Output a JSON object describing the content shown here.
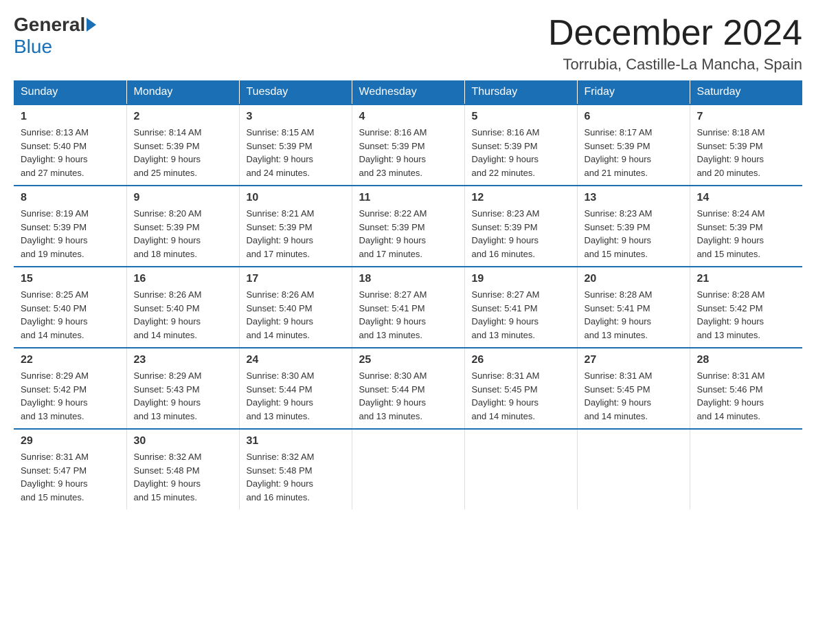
{
  "logo": {
    "general": "General",
    "blue": "Blue"
  },
  "title": "December 2024",
  "subtitle": "Torrubia, Castille-La Mancha, Spain",
  "days_of_week": [
    "Sunday",
    "Monday",
    "Tuesday",
    "Wednesday",
    "Thursday",
    "Friday",
    "Saturday"
  ],
  "weeks": [
    [
      {
        "day": "1",
        "sunrise": "8:13 AM",
        "sunset": "5:40 PM",
        "daylight": "9 hours and 27 minutes."
      },
      {
        "day": "2",
        "sunrise": "8:14 AM",
        "sunset": "5:39 PM",
        "daylight": "9 hours and 25 minutes."
      },
      {
        "day": "3",
        "sunrise": "8:15 AM",
        "sunset": "5:39 PM",
        "daylight": "9 hours and 24 minutes."
      },
      {
        "day": "4",
        "sunrise": "8:16 AM",
        "sunset": "5:39 PM",
        "daylight": "9 hours and 23 minutes."
      },
      {
        "day": "5",
        "sunrise": "8:16 AM",
        "sunset": "5:39 PM",
        "daylight": "9 hours and 22 minutes."
      },
      {
        "day": "6",
        "sunrise": "8:17 AM",
        "sunset": "5:39 PM",
        "daylight": "9 hours and 21 minutes."
      },
      {
        "day": "7",
        "sunrise": "8:18 AM",
        "sunset": "5:39 PM",
        "daylight": "9 hours and 20 minutes."
      }
    ],
    [
      {
        "day": "8",
        "sunrise": "8:19 AM",
        "sunset": "5:39 PM",
        "daylight": "9 hours and 19 minutes."
      },
      {
        "day": "9",
        "sunrise": "8:20 AM",
        "sunset": "5:39 PM",
        "daylight": "9 hours and 18 minutes."
      },
      {
        "day": "10",
        "sunrise": "8:21 AM",
        "sunset": "5:39 PM",
        "daylight": "9 hours and 17 minutes."
      },
      {
        "day": "11",
        "sunrise": "8:22 AM",
        "sunset": "5:39 PM",
        "daylight": "9 hours and 17 minutes."
      },
      {
        "day": "12",
        "sunrise": "8:23 AM",
        "sunset": "5:39 PM",
        "daylight": "9 hours and 16 minutes."
      },
      {
        "day": "13",
        "sunrise": "8:23 AM",
        "sunset": "5:39 PM",
        "daylight": "9 hours and 15 minutes."
      },
      {
        "day": "14",
        "sunrise": "8:24 AM",
        "sunset": "5:39 PM",
        "daylight": "9 hours and 15 minutes."
      }
    ],
    [
      {
        "day": "15",
        "sunrise": "8:25 AM",
        "sunset": "5:40 PM",
        "daylight": "9 hours and 14 minutes."
      },
      {
        "day": "16",
        "sunrise": "8:26 AM",
        "sunset": "5:40 PM",
        "daylight": "9 hours and 14 minutes."
      },
      {
        "day": "17",
        "sunrise": "8:26 AM",
        "sunset": "5:40 PM",
        "daylight": "9 hours and 14 minutes."
      },
      {
        "day": "18",
        "sunrise": "8:27 AM",
        "sunset": "5:41 PM",
        "daylight": "9 hours and 13 minutes."
      },
      {
        "day": "19",
        "sunrise": "8:27 AM",
        "sunset": "5:41 PM",
        "daylight": "9 hours and 13 minutes."
      },
      {
        "day": "20",
        "sunrise": "8:28 AM",
        "sunset": "5:41 PM",
        "daylight": "9 hours and 13 minutes."
      },
      {
        "day": "21",
        "sunrise": "8:28 AM",
        "sunset": "5:42 PM",
        "daylight": "9 hours and 13 minutes."
      }
    ],
    [
      {
        "day": "22",
        "sunrise": "8:29 AM",
        "sunset": "5:42 PM",
        "daylight": "9 hours and 13 minutes."
      },
      {
        "day": "23",
        "sunrise": "8:29 AM",
        "sunset": "5:43 PM",
        "daylight": "9 hours and 13 minutes."
      },
      {
        "day": "24",
        "sunrise": "8:30 AM",
        "sunset": "5:44 PM",
        "daylight": "9 hours and 13 minutes."
      },
      {
        "day": "25",
        "sunrise": "8:30 AM",
        "sunset": "5:44 PM",
        "daylight": "9 hours and 13 minutes."
      },
      {
        "day": "26",
        "sunrise": "8:31 AM",
        "sunset": "5:45 PM",
        "daylight": "9 hours and 14 minutes."
      },
      {
        "day": "27",
        "sunrise": "8:31 AM",
        "sunset": "5:45 PM",
        "daylight": "9 hours and 14 minutes."
      },
      {
        "day": "28",
        "sunrise": "8:31 AM",
        "sunset": "5:46 PM",
        "daylight": "9 hours and 14 minutes."
      }
    ],
    [
      {
        "day": "29",
        "sunrise": "8:31 AM",
        "sunset": "5:47 PM",
        "daylight": "9 hours and 15 minutes."
      },
      {
        "day": "30",
        "sunrise": "8:32 AM",
        "sunset": "5:48 PM",
        "daylight": "9 hours and 15 minutes."
      },
      {
        "day": "31",
        "sunrise": "8:32 AM",
        "sunset": "5:48 PM",
        "daylight": "9 hours and 16 minutes."
      },
      null,
      null,
      null,
      null
    ]
  ],
  "labels": {
    "sunrise": "Sunrise:",
    "sunset": "Sunset:",
    "daylight": "Daylight:"
  }
}
